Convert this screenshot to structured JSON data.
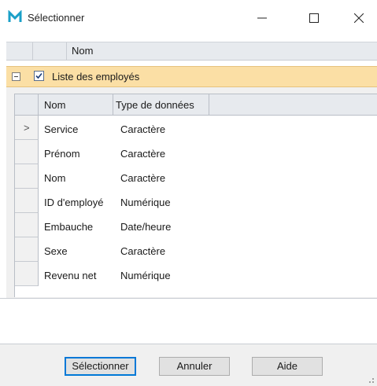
{
  "window": {
    "title": "Sélectionner",
    "accent": "#1aa0c8"
  },
  "outer_grid": {
    "column_header": "Nom",
    "master_row": {
      "label": "Liste des employés",
      "checked": true,
      "expanded": true,
      "highlight": "#fbdfa5"
    }
  },
  "inner_grid": {
    "columns": [
      "Nom",
      "Type de données"
    ],
    "current_row_indicator": ">",
    "rows": [
      {
        "name": "Service",
        "type": "Caractère"
      },
      {
        "name": "Prénom",
        "type": "Caractère"
      },
      {
        "name": "Nom",
        "type": "Caractère"
      },
      {
        "name": "ID d'employé",
        "type": "Numérique"
      },
      {
        "name": "Embauche",
        "type": "Date/heure"
      },
      {
        "name": "Sexe",
        "type": "Caractère"
      },
      {
        "name": "Revenu net",
        "type": "Numérique"
      }
    ]
  },
  "buttons": {
    "select": "Sélectionner",
    "cancel": "Annuler",
    "help": "Aide"
  },
  "icons": {
    "app": "app-logo-icon",
    "minimize": "minimize-icon",
    "maximize": "maximize-icon",
    "close": "close-icon",
    "collapse": "collapse-icon",
    "checkbox": "checkbox-checked-icon",
    "row_pointer": "row-pointer-icon",
    "resize": "resize-grip-icon"
  }
}
